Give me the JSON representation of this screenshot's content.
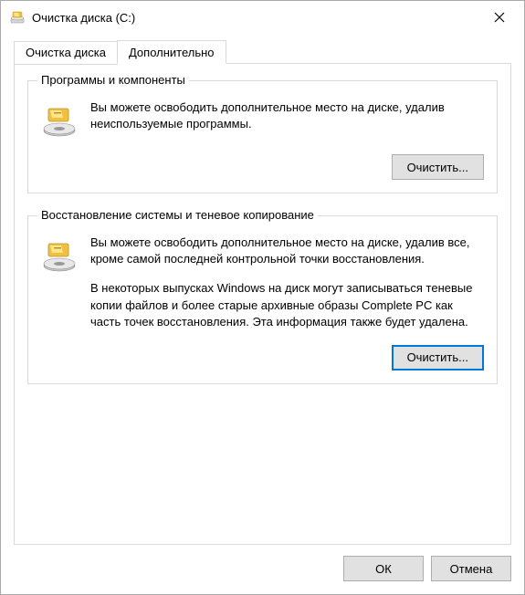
{
  "window": {
    "title": "Очистка диска  (C:)"
  },
  "tabs": {
    "cleanup": "Очистка диска",
    "more": "Дополнительно"
  },
  "groups": {
    "programs": {
      "title": "Программы и компоненты",
      "text": "Вы можете освободить дополнительное место на диске, удалив неиспользуемые программы.",
      "button": "Очистить..."
    },
    "restore": {
      "title": "Восстановление системы и теневое копирование",
      "text1": "Вы можете освободить дополнительное место на диске, удалив все, кроме самой последней контрольной точки восстановления.",
      "text2": "В некоторых выпусках Windows на диск могут записываться теневые копии файлов и более старые архивные образы Complete PC как часть точек восстановления. Эта информация также будет удалена.",
      "button": "Очистить..."
    }
  },
  "footer": {
    "ok": "ОК",
    "cancel": "Отмена"
  }
}
